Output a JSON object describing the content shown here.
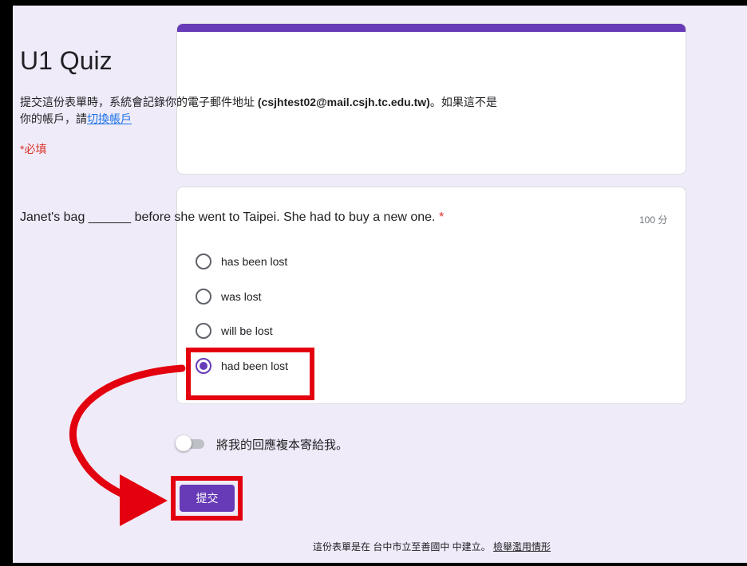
{
  "form": {
    "title": "U1 Quiz",
    "desc_prefix": "提交這份表單時，系統會記錄你的電子郵件地址 ",
    "email": "(csjhtest02@mail.csjh.tc.edu.tw)",
    "desc_middle": "。如果這不是你的帳戶，請",
    "switch_account_link": "切換帳戶",
    "required_note": "*必填",
    "accent_color": "#673ab7"
  },
  "question": {
    "text": "Janet's bag ______ before she went to Taipei. She had to buy a new one.",
    "required_star": "*",
    "points": "100 分",
    "options": [
      {
        "label": "has been lost",
        "selected": false
      },
      {
        "label": "was lost",
        "selected": false
      },
      {
        "label": "will be lost",
        "selected": false
      },
      {
        "label": "had been lost",
        "selected": true
      }
    ]
  },
  "copy_toggle": {
    "label": "將我的回應複本寄給我。",
    "on": false
  },
  "submit_label": "提交",
  "footer": {
    "text": "這份表單是在 台中市立至善國中 中建立。",
    "report_link": "檢舉濫用情形"
  },
  "annotation_color": "#e3000f"
}
